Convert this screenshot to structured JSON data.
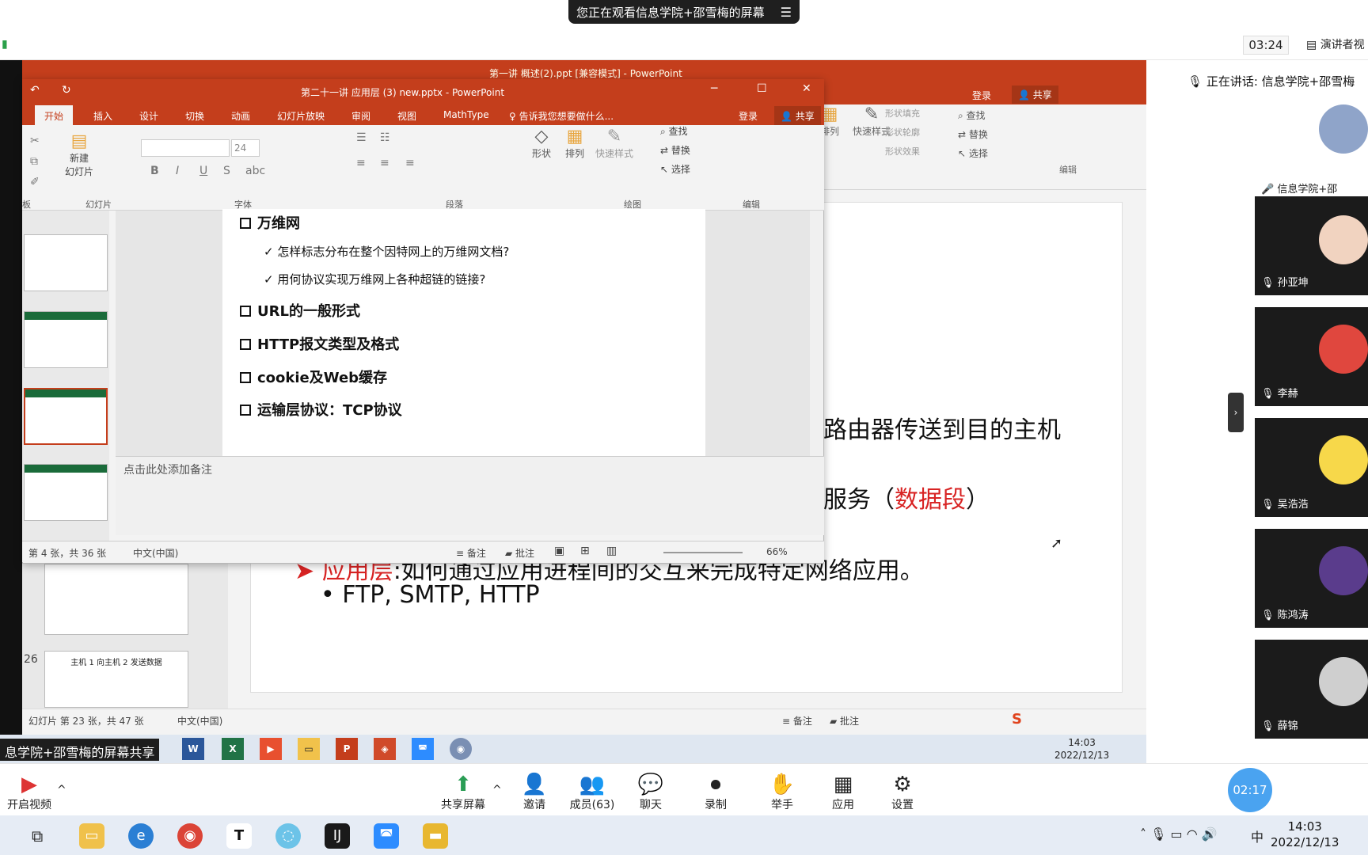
{
  "zoom": {
    "share_banner": "您正在观看信息学院+邵雪梅的屏幕",
    "meeting_timer": "03:24",
    "presenter_view": "演讲者视",
    "now_speaking": "正在讲话: 信息学院+邵雪梅",
    "share_label": "息学院+邵雪梅的屏幕共享",
    "mini_timer": "02:17",
    "toolbar": {
      "video": "开启视频",
      "share": "共享屏幕",
      "invite": "邀请",
      "members": "成员(63)",
      "chat": "聊天",
      "record": "录制",
      "raise_hand": "举手",
      "apps": "应用",
      "settings": "设置"
    },
    "participants": [
      {
        "name": "信息学院+邵"
      },
      {
        "name": "孙亚坤"
      },
      {
        "name": "李赫"
      },
      {
        "name": "吴浩浩"
      },
      {
        "name": "陈鸿涛"
      },
      {
        "name": "薛锦"
      }
    ]
  },
  "back_ppt": {
    "title": "第一讲 概述(2).ppt [兼容模式] - PowerPoint",
    "login": "登录",
    "share": "共享",
    "find": "查找",
    "replace": "替换",
    "select": "选择",
    "arrange": "排列",
    "quick_style": "快速样式",
    "shape_fill": "形状填充",
    "shape_outline": "形状轮廓",
    "shape_effect": "形状效果",
    "group_draw": "绘图",
    "group_edit": "编辑",
    "slide_line1": "路由器传送到目的主机",
    "slide_line2_prefix": "服务（",
    "slide_line2_red": "数据段",
    "slide_line2_suffix": "）",
    "slide_app_label": "应用层",
    "slide_app_rest": ":如何通过应用进程间的交互来完成特定网络应用。",
    "slide_bullet": "• FTP, SMTP, HTTP",
    "thumb_num": "26",
    "thumb_title": "主机 1 向主机 2 发送数据",
    "status_slide": "幻灯片 第 23 张，共 47 张",
    "status_lang": "中文(中国)",
    "status_notes": "备注",
    "status_comments": "批注"
  },
  "front_ppt": {
    "title": "第二十一讲 应用层 (3) new.pptx - PowerPoint",
    "tabs": [
      "开始",
      "插入",
      "设计",
      "切换",
      "动画",
      "幻灯片放映",
      "审阅",
      "视图",
      "MathType"
    ],
    "tell_me": "告诉我您想要做什么...",
    "login": "登录",
    "share": "共享",
    "font_size": "24",
    "new_slide": "新建\n幻灯片",
    "groups": {
      "clipboard": "板",
      "slides": "幻灯片",
      "font": "字体",
      "paragraph": "段落",
      "drawing": "绘图",
      "editing": "编辑"
    },
    "shape": "形状",
    "arrange": "排列",
    "quick_style": "快速样式",
    "find": "查找",
    "replace": "替换",
    "select": "选择",
    "outline": [
      {
        "level": 1,
        "text": "万维网"
      },
      {
        "level": 2,
        "text": "怎样标志分布在整个因特网上的万维网文档?"
      },
      {
        "level": 2,
        "text": "用何协议实现万维网上各种超链的链接?"
      },
      {
        "level": 1,
        "text": "URL的一般形式"
      },
      {
        "level": 1,
        "text": "HTTP报文类型及格式"
      },
      {
        "level": 1,
        "text": "cookie及Web缓存"
      },
      {
        "level": 1,
        "text": "运输层协议：TCP协议"
      }
    ],
    "notes_placeholder": "点击此处添加备注",
    "status_slide": "第 4 张，共 36 张",
    "status_lang": "中文(中国)",
    "status_notes": "备注",
    "status_comments": "批注",
    "zoom": "66%"
  },
  "shared_taskbar": {
    "time": "14:03",
    "date": "2022/12/13"
  },
  "windows": {
    "time": "14:03",
    "date": "2022/12/13",
    "ime": "中"
  }
}
